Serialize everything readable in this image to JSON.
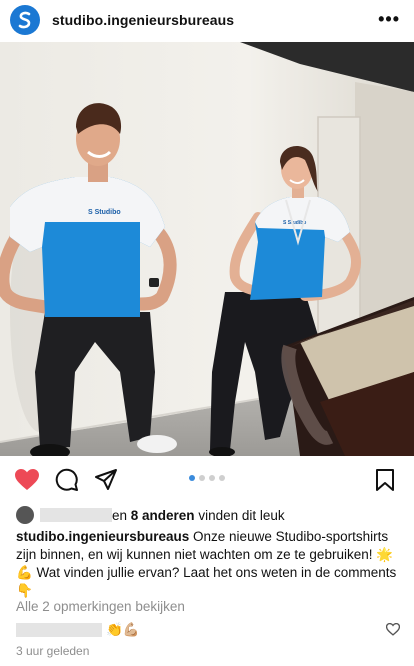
{
  "post": {
    "username": "studibo.ingenieursbureaus",
    "more_label": "•••"
  },
  "likes": {
    "prefix_hidden": "",
    "text_main": "en ",
    "count_text": "8 anderen",
    "text_suffix": " vinden dit leuk"
  },
  "caption": {
    "username": "studibo.ingenieursbureaus",
    "text": " Onze nieuwe Studibo-sportshirts zijn binnen, en wij kunnen niet wachten om ze te gebruiken! 🌟💪 Wat vinden jullie ervan? Laat het ons weten in de comments 👇"
  },
  "comments": {
    "view_all": "Alle 2 opmerkingen bekijken",
    "first_comment_text": "👏💪🏼"
  },
  "timestamp": "3 uur geleden",
  "carousel": {
    "count": 4,
    "active_index": 0
  },
  "colors": {
    "like_red": "#ed4956",
    "brand_blue": "#1b78d3",
    "dot_active": "#3a8bdc"
  },
  "icons": [
    "studibo-logo-icon",
    "more-icon",
    "heart-icon",
    "comment-icon",
    "share-icon",
    "bookmark-icon",
    "small-heart-icon"
  ]
}
